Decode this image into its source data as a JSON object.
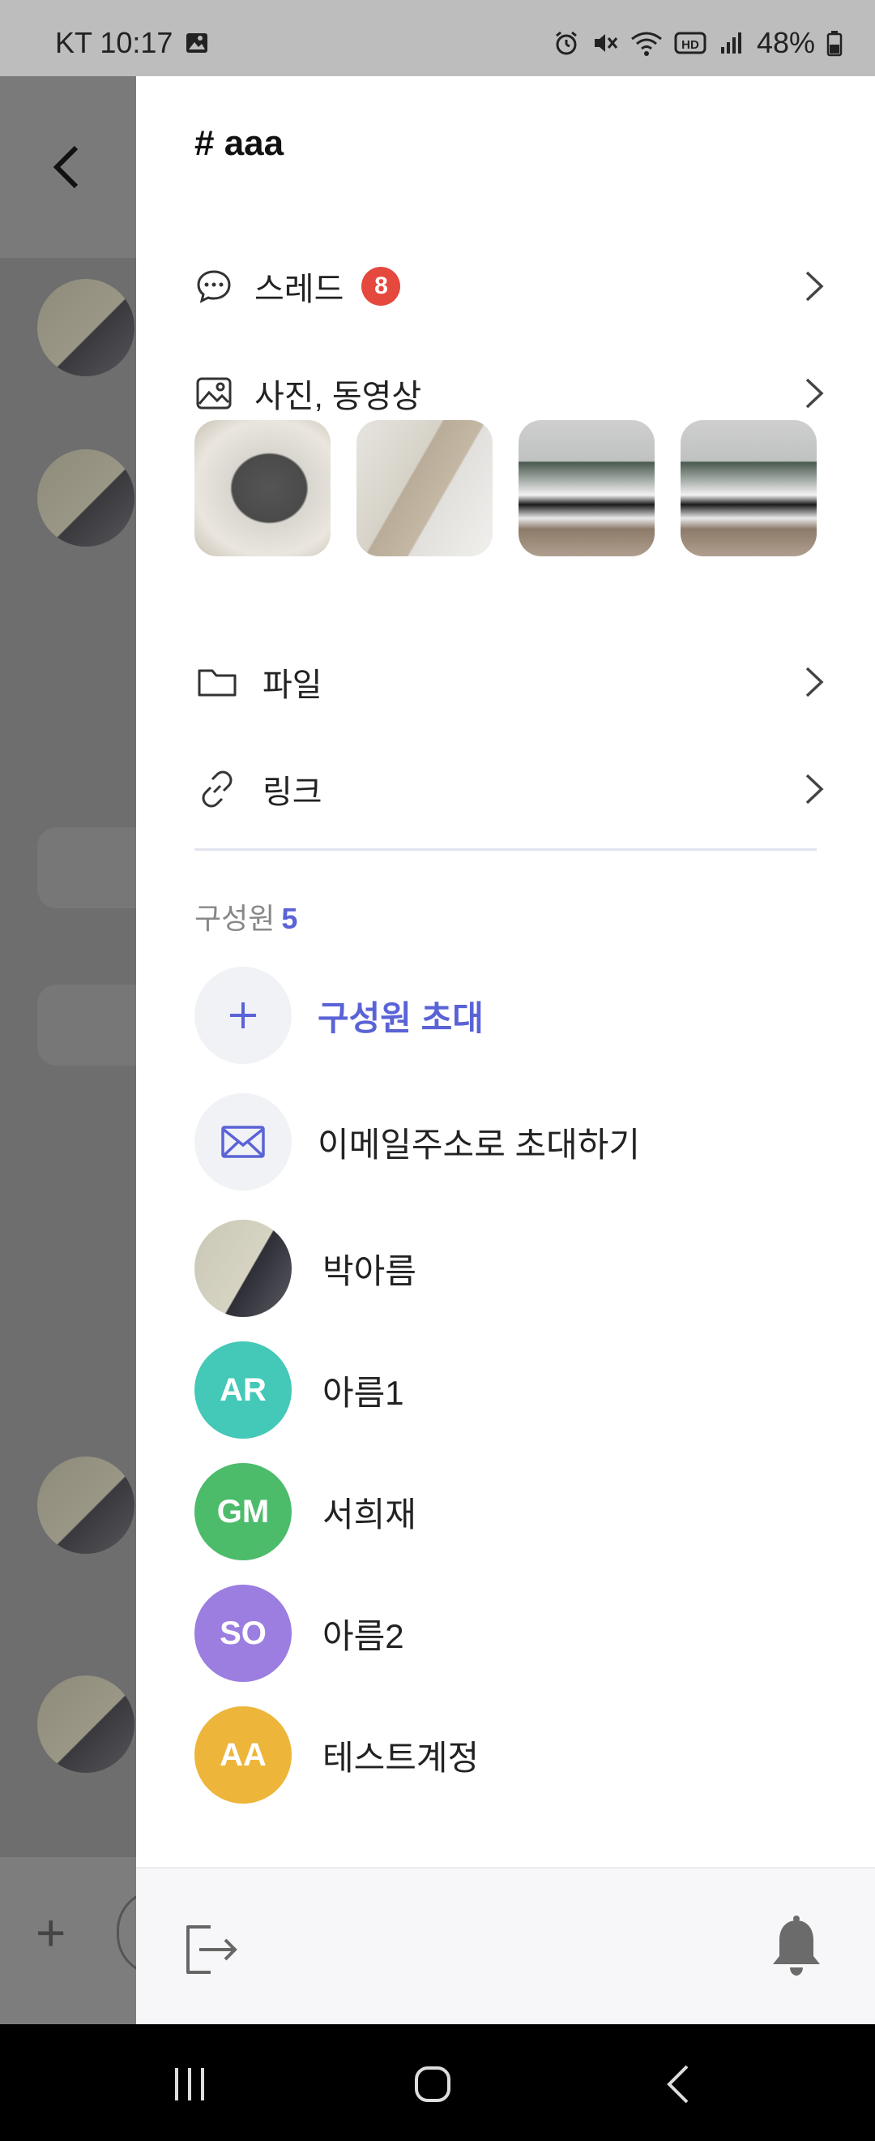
{
  "status_bar": {
    "carrier_time": "KT 10:17",
    "battery": "48%"
  },
  "channel": {
    "title": "# aaa"
  },
  "menu": {
    "thread_label": "스레드",
    "thread_badge": "8",
    "media_label": "사진, 동영상",
    "files_label": "파일",
    "links_label": "링크"
  },
  "members": {
    "heading": "구성원",
    "count": "5",
    "invite_label": "구성원 초대",
    "email_invite_label": "이메일주소로 초대하기",
    "list": [
      {
        "name": "박아름",
        "initials": "",
        "color": "#bdbaa8"
      },
      {
        "name": "아름1",
        "initials": "AR",
        "color": "#44c8b7"
      },
      {
        "name": "서희재",
        "initials": "GM",
        "color": "#4cbc6b"
      },
      {
        "name": "아름2",
        "initials": "SO",
        "color": "#9b7ee0"
      },
      {
        "name": "테스트계정",
        "initials": "AA",
        "color": "#edb63a"
      }
    ]
  },
  "colors": {
    "accent": "#5a63d6",
    "badge": "#e5483d"
  }
}
